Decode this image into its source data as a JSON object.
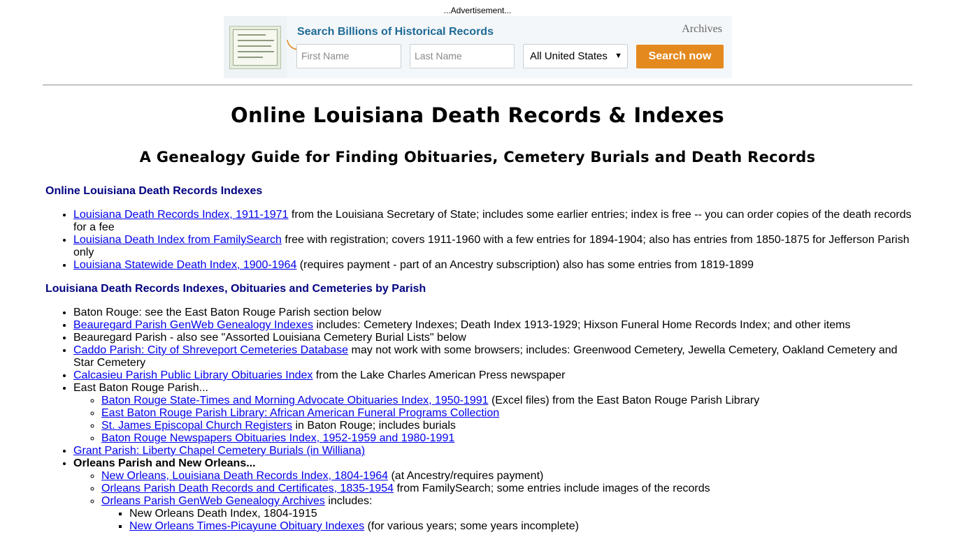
{
  "ad": {
    "label": "...Advertisement...",
    "title": "Search Billions of Historical Records",
    "brand": "Archives",
    "first_name_placeholder": "First Name",
    "last_name_placeholder": "Last Name",
    "location_selected": "All United States",
    "search_button": "Search now"
  },
  "page": {
    "title": "Online Louisiana Death Records & Indexes",
    "subtitle": "A Genealogy Guide for Finding Obituaries, Cemetery Burials and Death Records"
  },
  "section1": {
    "heading": "Online Louisiana Death Records Indexes",
    "items": [
      {
        "link": "Louisiana Death Records Index, 1911-1971",
        "text": " from the Louisiana Secretary of State; includes some earlier entries; index is free -- you can order copies of the death records for a fee"
      },
      {
        "link": "Louisiana Death Index from FamilySearch",
        "text": " free with registration; covers 1911-1960 with a few entries for 1894-1904; also has entries from 1850-1875 for Jefferson Parish only"
      },
      {
        "link": "Louisiana Statewide Death Index, 1900-1964",
        "text": " (requires payment - part of an Ancestry subscription) also has some entries from 1819-1899"
      }
    ]
  },
  "section2": {
    "heading": "Louisiana Death Records Indexes, Obituaries and Cemeteries by Parish",
    "item_baton_rouge": "Baton Rouge: see the East Baton Rouge Parish section below",
    "item_beauregard_link": "Beauregard Parish GenWeb Genealogy Indexes",
    "item_beauregard_text": " includes: Cemetery Indexes; Death Index 1913-1929; Hixson Funeral Home Records Index; and other items",
    "item_beauregard_see": "Beauregard Parish - also see \"Assorted Louisiana Cemetery Burial Lists\" below",
    "item_caddo_link": "Caddo Parish: City of Shreveport Cemeteries Database",
    "item_caddo_text": " may not work with some browsers; includes: Greenwood Cemetery, Jewella Cemetery, Oakland Cemetery and Star Cemetery",
    "item_calcasieu_link": "Calcasieu Parish Public Library Obituaries Index",
    "item_calcasieu_text": " from the Lake Charles American Press newspaper",
    "item_ebr": "East Baton Rouge Parish...",
    "ebr_sub": [
      {
        "link": "Baton Rouge State-Times and Morning Advocate Obituaries Index, 1950-1991",
        "text": " (Excel files) from the East Baton Rouge Parish Library"
      },
      {
        "link": "East Baton Rouge Parish Library: African American Funeral Programs Collection",
        "text": ""
      },
      {
        "link": "St. James Episcopal Church Registers",
        "text": " in Baton Rouge; includes burials"
      },
      {
        "link": "Baton Rouge Newspapers Obituaries Index, 1952-1959 and 1980-1991",
        "text": ""
      }
    ],
    "item_grant_link": "Grant Parish: Liberty Chapel Cemetery Burials (in Williana)",
    "item_orleans": "Orleans Parish and New Orleans...",
    "orleans_sub": [
      {
        "link": "New Orleans, Louisiana Death Records Index, 1804-1964",
        "text": " (at Ancestry/requires payment)"
      },
      {
        "link": "Orleans Parish Death Records and Certificates, 1835-1954",
        "text": " from FamilySearch; some entries include images of the records"
      },
      {
        "link": "Orleans Parish GenWeb Genealogy Archives",
        "text": " includes:"
      }
    ],
    "orleans_sub2_item1": "New Orleans Death Index, 1804-1915",
    "orleans_sub2_item2_link": "New Orleans Times-Picayune Obituary Indexes",
    "orleans_sub2_item2_text": " (for various years; some years incomplete)"
  }
}
